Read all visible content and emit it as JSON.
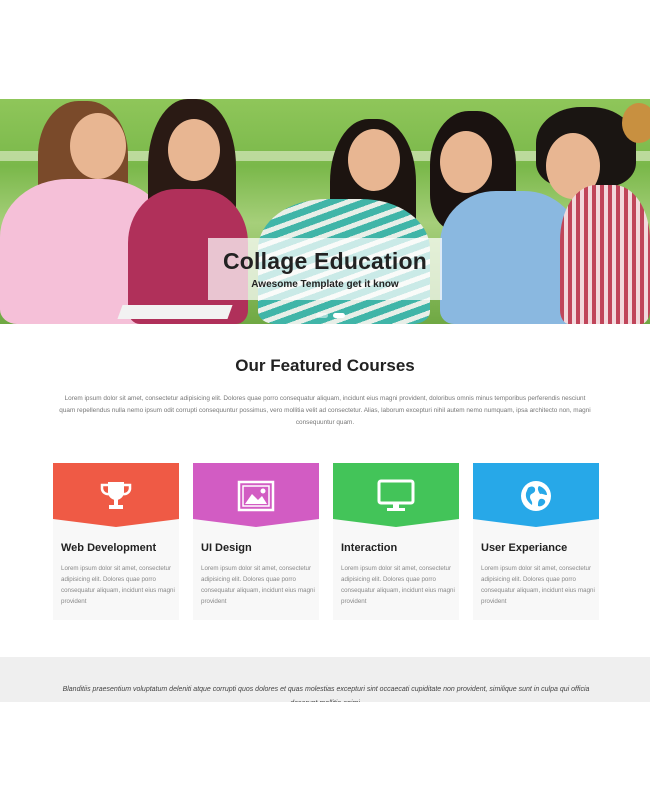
{
  "hero": {
    "title": "Collage Education",
    "subtitle": "Awesome Template get it know",
    "slides": 2,
    "active_slide": 2
  },
  "featured": {
    "title": "Our Featured Courses",
    "description": "Lorem ipsum dolor sit amet, consectetur adipisicing elit. Dolores quae porro consequatur aliquam, incidunt eius magni provident, doloribus omnis minus temporibus perferendis nesciunt quam repellendus nulla nemo ipsum odit corrupti consequuntur possimus, vero mollitia velit ad consectetur. Alias, laborum excepturi nihil autem nemo numquam, ipsa architecto non, magni consequuntur quam."
  },
  "cards": [
    {
      "title": "Web Development",
      "text": "Lorem ipsum dolor sit amet, consectetur adipisicing elit. Dolores quae porro consequatur aliquam, incidunt eius magni provident",
      "color": "#ef5a45",
      "icon": "trophy-icon"
    },
    {
      "title": "UI Design",
      "text": "Lorem ipsum dolor sit amet, consectetur adipisicing elit. Dolores quae porro consequatur aliquam, incidunt eius magni provident",
      "color": "#d25cc3",
      "icon": "image-icon"
    },
    {
      "title": "Interaction",
      "text": "Lorem ipsum dolor sit amet, consectetur adipisicing elit. Dolores quae porro consequatur aliquam, incidunt eius magni provident",
      "color": "#43c459",
      "icon": "monitor-icon"
    },
    {
      "title": "User Experiance",
      "text": "Lorem ipsum dolor sit amet, consectetur adipisicing elit. Dolores quae porro consequatur aliquam, incidunt eius magni provident",
      "color": "#27a8e8",
      "icon": "globe-icon"
    }
  ],
  "testimonial": {
    "text": "Blanditiis praesentium voluptatum deleniti atque corrupti quos dolores et quas molestias excepturi sint occaecati cupiditate non provident, similique sunt in culpa qui officia deserunt mollitia animi."
  }
}
